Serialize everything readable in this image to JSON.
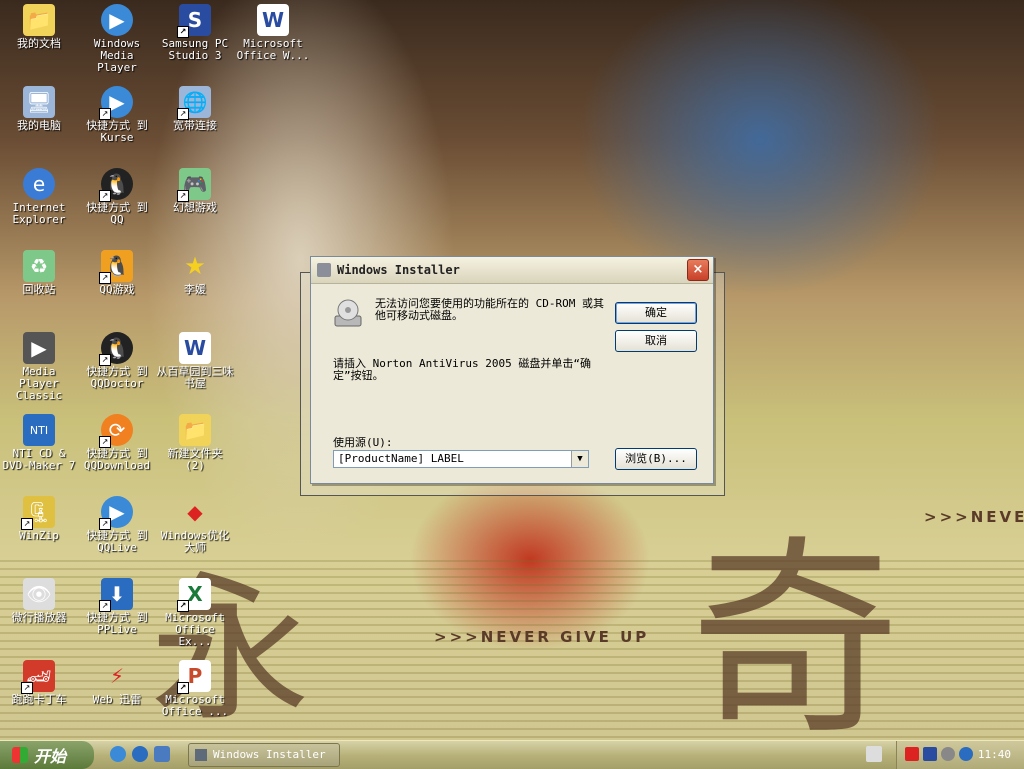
{
  "desktop": {
    "icons": [
      {
        "label": "我的文档"
      },
      {
        "label": "Windows Media Player"
      },
      {
        "label": "Samsung PC Studio 3"
      },
      {
        "label": "Microsoft Office W..."
      },
      {
        "label": "我的电脑"
      },
      {
        "label": "快捷方式 到 Kurse"
      },
      {
        "label": "宽带连接"
      },
      {
        "label": "Internet Explorer"
      },
      {
        "label": "快捷方式 到 QQ"
      },
      {
        "label": "幻想游戏"
      },
      {
        "label": "回收站"
      },
      {
        "label": "QQ游戏"
      },
      {
        "label": "李媛"
      },
      {
        "label": "Media Player Classic"
      },
      {
        "label": "快捷方式 到 QQDoctor"
      },
      {
        "label": "从百草园到三味书屋"
      },
      {
        "label": "NTI CD & DVD-Maker 7"
      },
      {
        "label": "快捷方式 到 QQDownload"
      },
      {
        "label": "新建文件夹 (2)"
      },
      {
        "label": "WinZip"
      },
      {
        "label": "快捷方式 到 QQLive"
      },
      {
        "label": "Windows优化大师"
      },
      {
        "label": "微行播放器"
      },
      {
        "label": "快捷方式 到 PPLive"
      },
      {
        "label": "Microsoft Office Ex..."
      },
      {
        "label": "跑跑卡丁车"
      },
      {
        "label": "Web 迅雷"
      },
      {
        "label": "Microsoft Office ..."
      }
    ],
    "wallpaper": {
      "slogan1": ">>>NEVER",
      "slogan2": ">>>NEVER GIVE UP"
    }
  },
  "dialog": {
    "title": "Windows Installer",
    "close": "×",
    "message1": "无法访问您要使用的功能所在的 CD-ROM 或其他可移动式磁盘。",
    "message2": "请插入 Norton AntiVirus 2005 磁盘并单击“确定”按钮。",
    "ok": "确定",
    "cancel": "取消",
    "source_label": "使用源(U):",
    "source_value": "[ProductName] LABEL",
    "browse": "浏览(B)..."
  },
  "taskbar": {
    "start": "开始",
    "task": "Windows Installer",
    "clock": "11:40"
  },
  "colors": {
    "accent": "#003c74",
    "taskbar": "#b8b27a",
    "close": "#c8402a"
  }
}
